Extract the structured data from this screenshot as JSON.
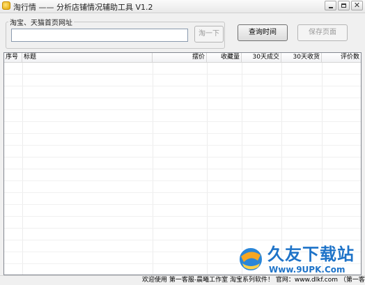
{
  "window": {
    "title": "淘行情 —— 分析店铺情况辅助工具 V1.2",
    "icon": "app-icon"
  },
  "url_group": {
    "legend": "淘宝、天猫首页网址",
    "input_value": "",
    "input_placeholder": ""
  },
  "buttons": {
    "search": "淘一下",
    "query": "查询时间",
    "save": "保存页面"
  },
  "table": {
    "columns": [
      "序号",
      "标题",
      "摆价",
      "收藏量",
      "30天成交",
      "30天收货",
      "评价数"
    ],
    "rows": []
  },
  "status_text": "欢迎使用 第一客服-晨曦工作室 淘宝系列软件！  官网：www.dlkf.com （第一客服）",
  "watermark": {
    "title": "久友下载站",
    "url": "Www.9UPK.Com"
  }
}
